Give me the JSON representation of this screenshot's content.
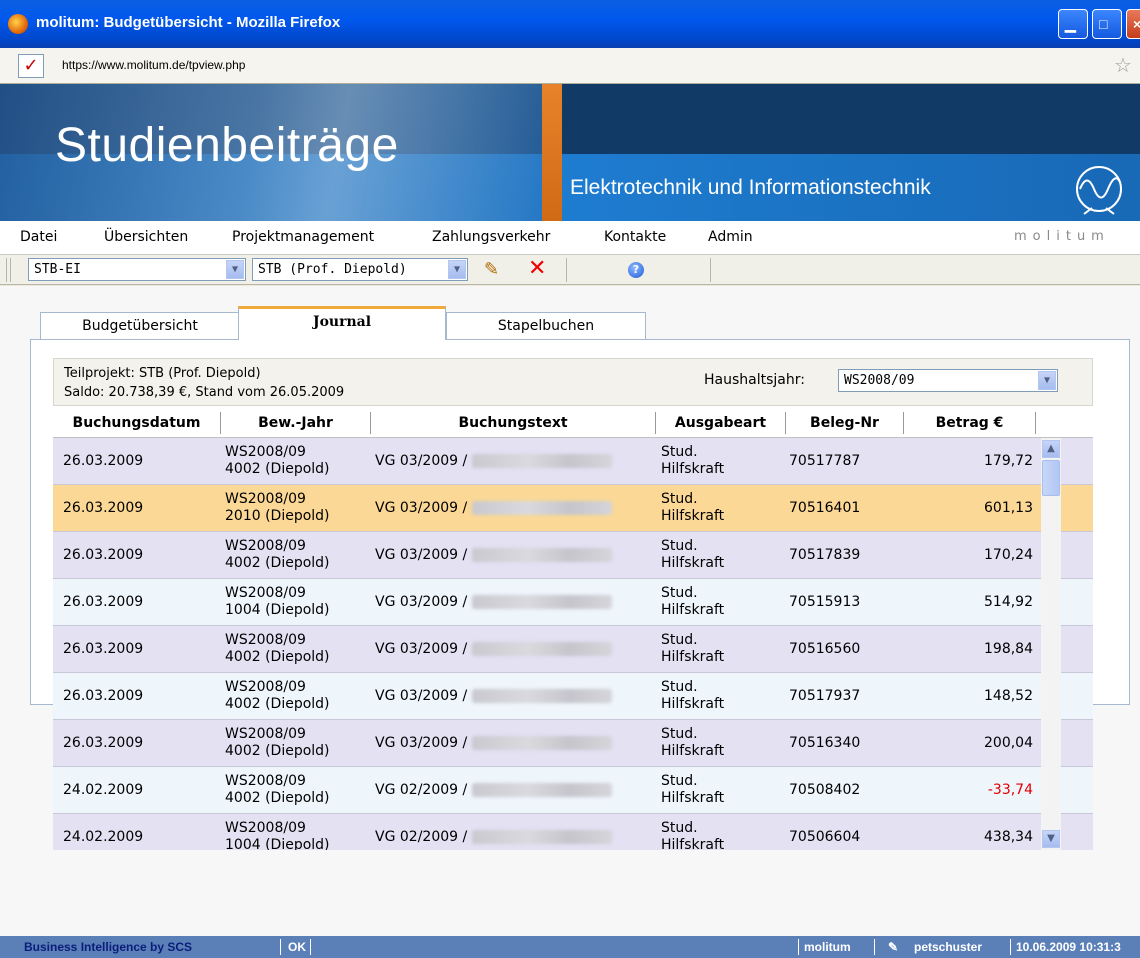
{
  "window": {
    "title": "molitum: Budgetübersicht - Mozilla Firefox"
  },
  "urlbar": {
    "url": "https://www.molitum.de/tpview.php"
  },
  "banner": {
    "title": "Studienbeiträge",
    "subtitle": "Elektrotechnik und Informationstechnik"
  },
  "menu": {
    "items": [
      "Datei",
      "Übersichten",
      "Projektmanagement",
      "Zahlungsverkehr",
      "Kontakte",
      "Admin"
    ],
    "brand": "molitum"
  },
  "toolbar": {
    "project_select": "STB-EI",
    "subproject_select": "STB (Prof. Diepold)"
  },
  "tabs": [
    "Budgetübersicht",
    "Journal",
    "Stapelbuchen"
  ],
  "info": {
    "teilprojekt": "Teilprojekt: STB (Prof. Diepold)",
    "saldo": "Saldo: 20.738,39 €, Stand vom 26.05.2009",
    "haushaltsjahr_label": "Haushaltsjahr:",
    "haushaltsjahr_value": "WS2008/09"
  },
  "table": {
    "headers": [
      "Buchungsdatum",
      "Bew.-Jahr",
      "Buchungstext",
      "Ausgabeart",
      "Beleg-Nr",
      "Betrag €"
    ],
    "rows": [
      {
        "date": "26.03.2009",
        "year1": "WS2008/09",
        "year2": "4002 (Diepold)",
        "text": "VG 03/2009 /",
        "type1": "Stud.",
        "type2": "Hilfskraft",
        "beleg": "70517787",
        "amount": "179,72"
      },
      {
        "date": "26.03.2009",
        "year1": "WS2008/09",
        "year2": "2010 (Diepold)",
        "text": "VG 03/2009 /",
        "type1": "Stud.",
        "type2": "Hilfskraft",
        "beleg": "70516401",
        "amount": "601,13"
      },
      {
        "date": "26.03.2009",
        "year1": "WS2008/09",
        "year2": "4002 (Diepold)",
        "text": "VG 03/2009 /",
        "type1": "Stud.",
        "type2": "Hilfskraft",
        "beleg": "70517839",
        "amount": "170,24"
      },
      {
        "date": "26.03.2009",
        "year1": "WS2008/09",
        "year2": "1004 (Diepold)",
        "text": "VG 03/2009 /",
        "type1": "Stud.",
        "type2": "Hilfskraft",
        "beleg": "70515913",
        "amount": "514,92"
      },
      {
        "date": "26.03.2009",
        "year1": "WS2008/09",
        "year2": "4002 (Diepold)",
        "text": "VG 03/2009 /",
        "type1": "Stud.",
        "type2": "Hilfskraft",
        "beleg": "70516560",
        "amount": "198,84"
      },
      {
        "date": "26.03.2009",
        "year1": "WS2008/09",
        "year2": "4002 (Diepold)",
        "text": "VG 03/2009 /",
        "type1": "Stud.",
        "type2": "Hilfskraft",
        "beleg": "70517937",
        "amount": "148,52"
      },
      {
        "date": "26.03.2009",
        "year1": "WS2008/09",
        "year2": "4002 (Diepold)",
        "text": "VG 03/2009 /",
        "type1": "Stud.",
        "type2": "Hilfskraft",
        "beleg": "70516340",
        "amount": "200,04"
      },
      {
        "date": "24.02.2009",
        "year1": "WS2008/09",
        "year2": "4002 (Diepold)",
        "text": "VG 02/2009 /",
        "type1": "Stud.",
        "type2": "Hilfskraft",
        "beleg": "70508402",
        "amount": "-33,74"
      },
      {
        "date": "24.02.2009",
        "year1": "WS2008/09",
        "year2": "1004 (Diepold)",
        "text": "VG 02/2009 /",
        "type1": "Stud.",
        "type2": "Hilfskraft",
        "beleg": "70506604",
        "amount": "438,34"
      }
    ]
  },
  "status": {
    "brand": "Business Intelligence by SCS",
    "ok": "OK",
    "app": "molitum",
    "user": "petschuster",
    "datetime": "10.06.2009 10:31:3"
  },
  "colors": {
    "accent_tab": "#f2a93b",
    "highlight_row": "#fbd895",
    "negative": "#e00000"
  }
}
